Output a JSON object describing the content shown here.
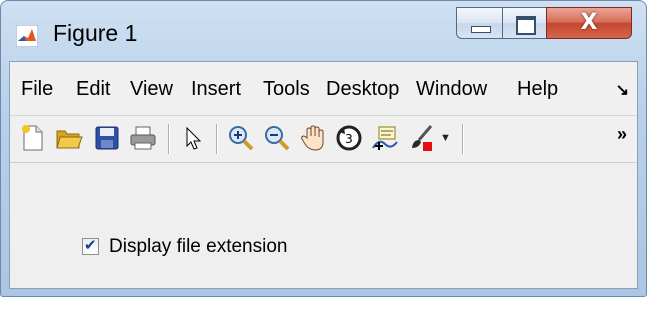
{
  "window": {
    "title": "Figure 1",
    "close_glyph": "X",
    "menu": [
      "File",
      "Edit",
      "View",
      "Insert",
      "Tools",
      "Desktop",
      "Window",
      "Help"
    ],
    "menu_overflow": "↘",
    "toolbar": [
      "new-figure-icon",
      "open-file-icon",
      "save-icon",
      "print-icon",
      "pointer-icon",
      "zoom-in-icon",
      "zoom-out-icon",
      "pan-icon",
      "rotate-3d-icon",
      "data-cursor-icon",
      "brush-icon"
    ],
    "toolbar_overflow": "»"
  },
  "content": {
    "checkbox_label": "Display file extension",
    "checkbox_checked": true
  },
  "colors": {
    "accent_close": "#c5472f",
    "checkmark": "#1f3c8a"
  }
}
